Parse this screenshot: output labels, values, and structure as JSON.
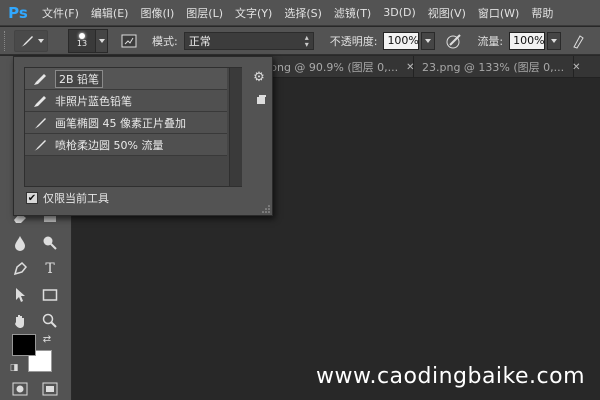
{
  "app": {
    "logo": "Ps"
  },
  "menu": [
    "文件(F)",
    "编辑(E)",
    "图像(I)",
    "图层(L)",
    "文字(Y)",
    "选择(S)",
    "滤镜(T)",
    "3D(D)",
    "视图(V)",
    "窗口(W)",
    "帮助"
  ],
  "options": {
    "brush_size": "13",
    "mode_label": "模式:",
    "mode_value": "正常",
    "opacity_label": "不透明度:",
    "opacity_value": "100%",
    "flow_label": "流量:",
    "flow_value": "100%"
  },
  "tabs": [
    {
      "label": "png @ 90.9% (图层 0,...",
      "close": "✕"
    },
    {
      "label": "23.png @ 133% (图层 0,...",
      "close": "✕"
    }
  ],
  "picker": {
    "presets": [
      {
        "label": "2B 铅笔",
        "icon": "pencil-brush-icon"
      },
      {
        "label": "非照片蓝色铅笔",
        "icon": "pencil-brush-icon"
      },
      {
        "label": "画笔椭圆 45 像素正片叠加",
        "icon": "brush-icon"
      },
      {
        "label": "喷枪柔边圆 50% 流量",
        "icon": "airbrush-icon"
      }
    ],
    "only_current_label": "仅限当前工具",
    "only_current_checked": true
  },
  "toolbar": {
    "type_tool_glyph": "T",
    "foreground_color": "#000000",
    "background_color": "#ffffff"
  },
  "watermark": "www.caodingbaike.com"
}
